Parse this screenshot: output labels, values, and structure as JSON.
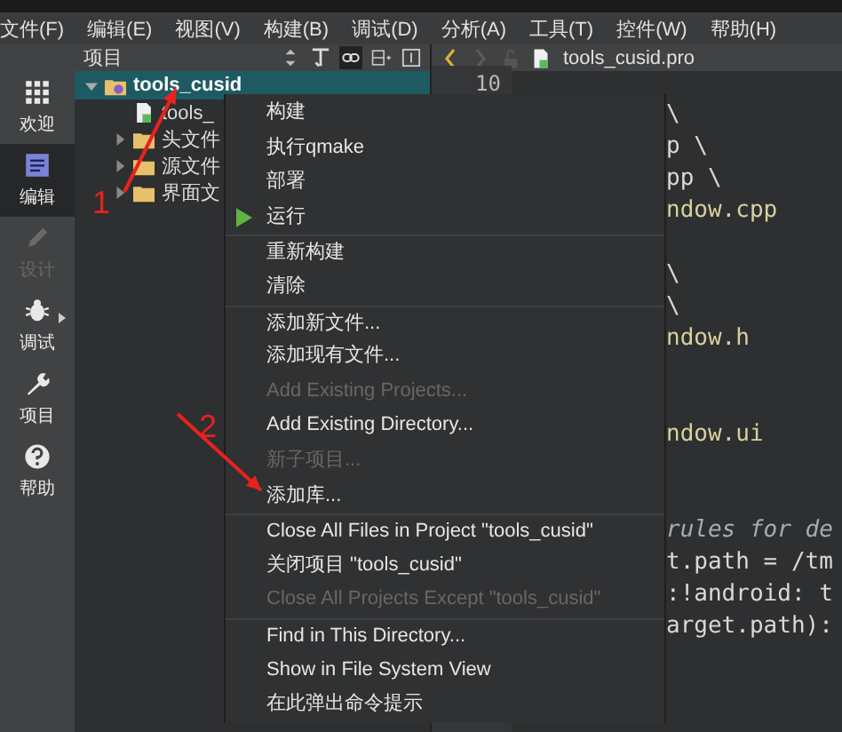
{
  "menu_bar": [
    "文件(F)",
    "编辑(E)",
    "视图(V)",
    "构建(B)",
    "调试(D)",
    "分析(A)",
    "工具(T)",
    "控件(W)",
    "帮助(H)"
  ],
  "mode_bar": [
    {
      "label": "欢迎",
      "selected": false,
      "disabled": false,
      "submenu": false
    },
    {
      "label": "编辑",
      "selected": true,
      "disabled": false,
      "submenu": false
    },
    {
      "label": "设计",
      "selected": false,
      "disabled": true,
      "submenu": false
    },
    {
      "label": "调试",
      "selected": false,
      "disabled": false,
      "submenu": true
    },
    {
      "label": "项目",
      "selected": false,
      "disabled": false,
      "submenu": false
    },
    {
      "label": "帮助",
      "selected": false,
      "disabled": false,
      "submenu": false
    }
  ],
  "project_panel": {
    "title": "项目",
    "tree": [
      {
        "label": "tools_cusid",
        "kind": "project",
        "selected": true,
        "expanded": true,
        "children": [
          {
            "label": "tools_",
            "kind": "pro-file",
            "selected": false
          },
          {
            "label": "头文件",
            "kind": "folder",
            "selected": false,
            "expanded": false
          },
          {
            "label": "源文件",
            "kind": "folder",
            "selected": false,
            "expanded": false
          },
          {
            "label": "界面文",
            "kind": "folder",
            "selected": false,
            "expanded": false
          }
        ]
      }
    ]
  },
  "editor": {
    "file_name": "tools_cusid.pro",
    "lines": [
      {
        "kind": "blank",
        "number": "10"
      },
      {
        "kind": "code",
        "text": "\\"
      },
      {
        "kind": "code",
        "text": "p \\"
      },
      {
        "kind": "code",
        "text": "pp \\"
      },
      {
        "kind": "file",
        "text": "ndow.cpp"
      },
      {
        "kind": "blank"
      },
      {
        "kind": "code",
        "text": "\\"
      },
      {
        "kind": "code",
        "text": "\\"
      },
      {
        "kind": "file",
        "text": "ndow.h"
      },
      {
        "kind": "blank"
      },
      {
        "kind": "blank"
      },
      {
        "kind": "file",
        "text": "ndow.ui"
      },
      {
        "kind": "blank"
      },
      {
        "kind": "blank"
      },
      {
        "kind": "comment",
        "text": "rules for de"
      },
      {
        "kind": "code",
        "text": "t.path = /tm"
      },
      {
        "kind": "code",
        "text": ":!android: t"
      },
      {
        "kind": "code",
        "text": "arget.path):"
      }
    ]
  },
  "context_menu": [
    [
      {
        "label": "构建",
        "kind": "action",
        "disabled": false
      },
      {
        "label": "执行qmake",
        "kind": "action",
        "disabled": false
      },
      {
        "label": "部署",
        "kind": "action",
        "disabled": false
      },
      {
        "label": "运行",
        "kind": "run",
        "disabled": false
      }
    ],
    [
      {
        "label": "重新构建",
        "kind": "action",
        "disabled": false
      },
      {
        "label": "清除",
        "kind": "action",
        "disabled": false
      }
    ],
    [
      {
        "label": "添加新文件...",
        "kind": "action",
        "disabled": false
      },
      {
        "label": "添加现有文件...",
        "kind": "action",
        "disabled": false
      },
      {
        "label": "Add Existing Projects...",
        "kind": "action",
        "disabled": true
      },
      {
        "label": "Add Existing Directory...",
        "kind": "action",
        "disabled": false
      },
      {
        "label": "新子项目...",
        "kind": "action",
        "disabled": true
      },
      {
        "label": "添加库...",
        "kind": "action",
        "disabled": false
      }
    ],
    [
      {
        "label": "Close All Files in Project \"tools_cusid\"",
        "kind": "action",
        "disabled": false
      },
      {
        "label": "关闭项目 \"tools_cusid\"",
        "kind": "action",
        "disabled": false
      },
      {
        "label": "Close All Projects Except \"tools_cusid\"",
        "kind": "action",
        "disabled": true
      }
    ],
    [
      {
        "label": "Find in This Directory...",
        "kind": "action",
        "disabled": false
      },
      {
        "label": "Show in File System View",
        "kind": "action",
        "disabled": false
      },
      {
        "label": "在此弹出命令提示",
        "kind": "action",
        "disabled": false
      }
    ]
  ],
  "annotations": [
    {
      "label": "1"
    },
    {
      "label": "2"
    }
  ]
}
